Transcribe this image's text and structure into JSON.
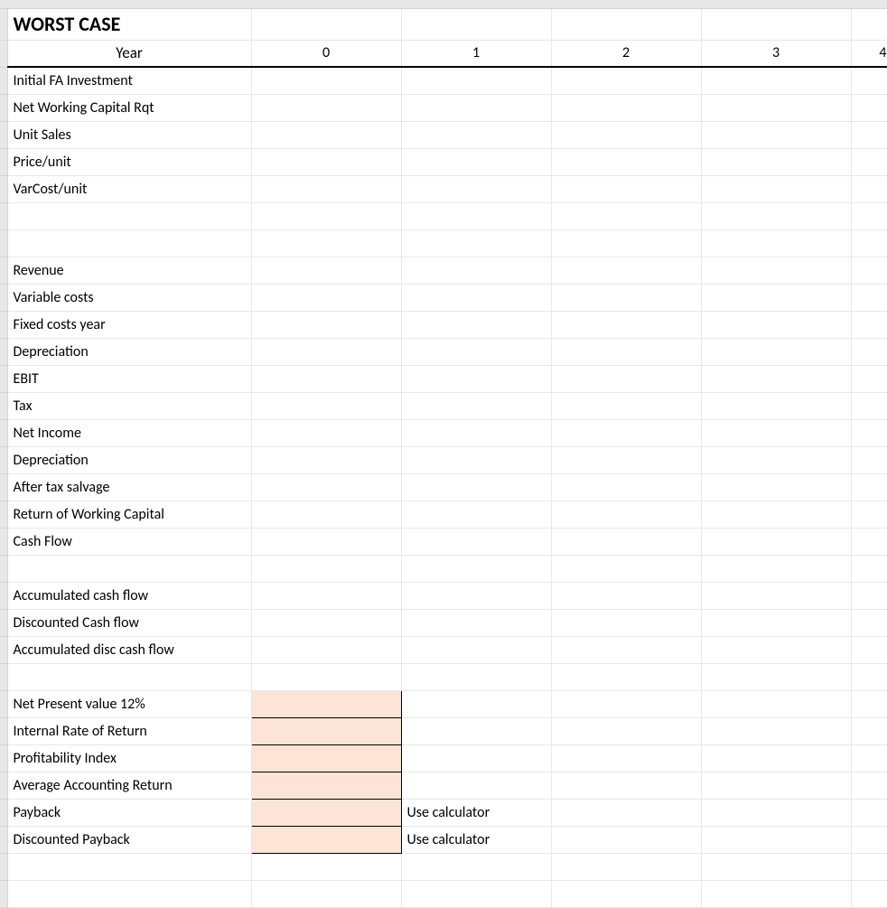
{
  "title": "WORST CASE",
  "header": {
    "yearLabel": "Year",
    "cols": [
      "0",
      "1",
      "2",
      "3",
      "4"
    ]
  },
  "rows": [
    {
      "label": "Initial FA Investment"
    },
    {
      "label": "Net Working Capital Rqt"
    },
    {
      "label": "Unit Sales"
    },
    {
      "label": "Price/unit"
    },
    {
      "label": "VarCost/unit"
    },
    {
      "label": ""
    },
    {
      "label": ""
    },
    {
      "label": "Revenue"
    },
    {
      "label": "Variable costs"
    },
    {
      "label": "Fixed costs year"
    },
    {
      "label": "Depreciation"
    },
    {
      "label": "EBIT"
    },
    {
      "label": "Tax"
    },
    {
      "label": "Net Income"
    },
    {
      "label": "Depreciation"
    },
    {
      "label": "After tax salvage"
    },
    {
      "label": "Return of Working Capital"
    },
    {
      "label": "Cash Flow"
    },
    {
      "label": ""
    },
    {
      "label": "Accumulated cash flow"
    },
    {
      "label": "Discounted Cash flow"
    },
    {
      "label": "Accumulated disc cash flow"
    },
    {
      "label": ""
    }
  ],
  "summary": [
    {
      "label": "Net Present value 12%",
      "note": ""
    },
    {
      "label": "Internal Rate of Return",
      "note": ""
    },
    {
      "label": "Profitability Index",
      "note": ""
    },
    {
      "label": "Average Accounting Return",
      "note": ""
    },
    {
      "label": "Payback",
      "note": "Use calculator"
    },
    {
      "label": "Discounted Payback",
      "note": "Use calculator"
    }
  ]
}
